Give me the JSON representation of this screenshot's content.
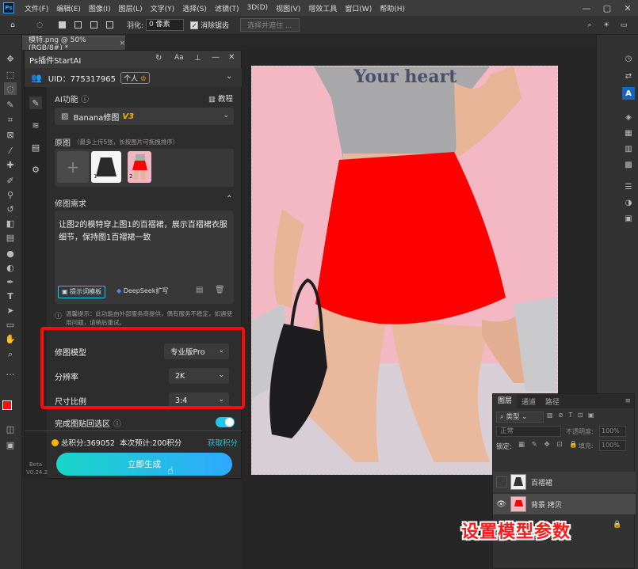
{
  "menubar": {
    "logo": "Ps",
    "items": [
      "文件(F)",
      "编辑(E)",
      "图像(I)",
      "图层(L)",
      "文字(Y)",
      "选择(S)",
      "滤镜(T)",
      "3D(D)",
      "视图(V)",
      "增效工具",
      "窗口(W)",
      "帮助(H)"
    ]
  },
  "options": {
    "feather_label": "羽化:",
    "feather_value": "0 像素",
    "antialias_label": "消除锯齿",
    "select_subject": "选择并遮住 ..."
  },
  "document_tab": {
    "title": "模特.png @ 50%(RGB/8#) *",
    "close": "×"
  },
  "plugin": {
    "title": "Ps插件StartAI",
    "uid_label": "UID：775317965",
    "account_tag": "个人",
    "ai_function_label": "AI功能",
    "tutorial_label": "教程",
    "function_value": "Banana修图",
    "function_version": "V3",
    "original_label": "原图",
    "original_hint": "（最多上传5张，长按图片可拖拽排序）",
    "add_symbol": "+",
    "thumb1_index": "1",
    "thumb2_index": "2",
    "requirement_label": "修图需求",
    "prompt_text": "让图2的模特穿上图1的百褶裙，展示百褶裙衣服细节，保持图1百褶裙一致",
    "prompt_template_label": "提示词模板",
    "deepseek_label": "DeepSeek扩写",
    "notice_text": "温馨提示：此功能由外部服务商提供，偶有服务不稳定，如遇使用问题，请稍后重试。",
    "model_label": "修图模型",
    "model_value": "专业版Pro",
    "resolution_label": "分辨率",
    "resolution_value": "2K",
    "ratio_label": "尺寸比例",
    "ratio_value": "3:4",
    "paste_back_label": "完成图贴回选区",
    "paste_back_on": true,
    "total_points": "总积分:369052",
    "estimate_points": "本次预计:200积分",
    "get_points": "获取积分",
    "generate_button": "立即生成",
    "beta_label": "Beta",
    "version_label": "V0.24.2"
  },
  "canvas": {
    "shirt_text": "Your heart"
  },
  "layers_panel": {
    "tabs": [
      "图层",
      "通道",
      "路径"
    ],
    "filter_kind": "类型",
    "blend_mode": "正常",
    "opacity_label": "不透明度:",
    "opacity_value": "100%",
    "lock_label": "锁定:",
    "fill_label": "填充:",
    "fill_value": "100%",
    "layers": [
      {
        "name": "百褶裙",
        "visible": false
      },
      {
        "name": "背景 拷贝",
        "visible": true
      }
    ]
  },
  "caption": "设置模型参数",
  "colors": {
    "accent_cyan": "#1ec8e8",
    "annotation_red": "#ff0a0a",
    "skirt_red": "#ff0000",
    "points_gold": "#f5b400"
  }
}
